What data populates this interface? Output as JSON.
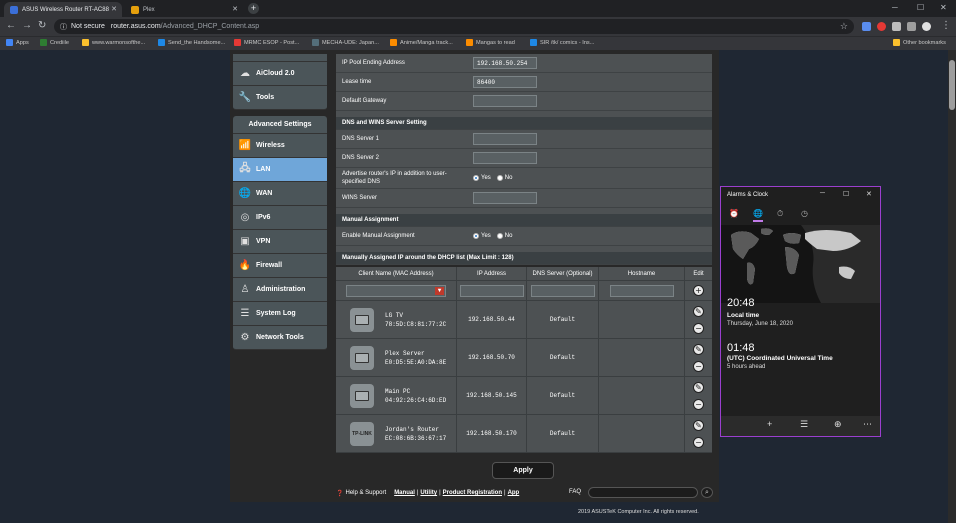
{
  "browser": {
    "tabs": [
      {
        "title": "ASUS Wireless Router RT-AC88"
      },
      {
        "title": "Plex"
      }
    ],
    "url": {
      "security": "Not secure",
      "host": "router.asus.com",
      "path": "/Advanced_DHCP_Content.asp"
    },
    "bookmarks": [
      {
        "label": "Apps",
        "color": "#4285f4"
      },
      {
        "label": "Crediile",
        "color": "#2e7d32"
      },
      {
        "label": "www.warmonsofthe...",
        "color": "#fbc02d"
      },
      {
        "label": "Send_the Handsome...",
        "color": "#1e88e5"
      },
      {
        "label": "MRMC ESOP - Post...",
        "color": "#e53935"
      },
      {
        "label": "MECHA-UDE: Japan...",
        "color": "#546e7a"
      },
      {
        "label": "Anime/Manga track...",
        "color": "#fb8c00"
      },
      {
        "label": "Mangas to read",
        "color": "#fb8c00"
      },
      {
        "label": "SIR /tk/ comics - Ins...",
        "color": "#1e88e5"
      },
      {
        "label": "Other bookmarks",
        "color": "#fbc02d"
      }
    ]
  },
  "sidebar": {
    "top_items": [
      {
        "label": "AiCloud 2.0",
        "icon": "cloud-icon"
      },
      {
        "label": "Tools",
        "icon": "wrench-icon"
      }
    ],
    "advanced_header": "Advanced Settings",
    "items": [
      {
        "label": "Wireless",
        "icon": "wireless-icon",
        "active": false
      },
      {
        "label": "LAN",
        "icon": "lan-icon",
        "active": true
      },
      {
        "label": "WAN",
        "icon": "globe-icon",
        "active": false
      },
      {
        "label": "IPv6",
        "icon": "ipv6-icon",
        "active": false
      },
      {
        "label": "VPN",
        "icon": "vpn-icon",
        "active": false
      },
      {
        "label": "Firewall",
        "icon": "fire-icon",
        "active": false
      },
      {
        "label": "Administration",
        "icon": "admin-icon",
        "active": false
      },
      {
        "label": "System Log",
        "icon": "log-icon",
        "active": false
      },
      {
        "label": "Network Tools",
        "icon": "gear-icon",
        "active": false
      }
    ]
  },
  "dhcp": {
    "pool_end_label": "IP Pool Ending Address",
    "pool_end_value": "192.168.50.254",
    "lease_label": "Lease time",
    "lease_value": "86400",
    "gateway_label": "Default Gateway",
    "gateway_value": ""
  },
  "dns": {
    "section_title": "DNS and WINS Server Setting",
    "dns1_label": "DNS Server 1",
    "dns2_label": "DNS Server 2",
    "advertise_label": "Advertise router's IP in addition to user-specified DNS",
    "yes": "Yes",
    "no": "No",
    "wins_label": "WINS Server"
  },
  "manual": {
    "section_title": "Manual Assignment",
    "enable_label": "Enable Manual Assignment",
    "yes": "Yes",
    "no": "No",
    "list_title": "Manually Assigned IP around the DHCP list (Max Limit : 128)"
  },
  "table": {
    "headers": [
      "Client Name (MAC Address)",
      "IP Address",
      "DNS Server (Optional)",
      "Hostname",
      "Edit"
    ],
    "rows": [
      {
        "name": "LG TV",
        "mac": "78:5D:C8:81:77:2C",
        "ip": "192.168.50.44",
        "dns": "Default",
        "icon": "tv-icon"
      },
      {
        "name": "Plex Server",
        "mac": "E0:D5:5E:A0:DA:8E",
        "ip": "192.168.50.70",
        "dns": "Default",
        "icon": "computer-icon"
      },
      {
        "name": "Main PC",
        "mac": "04:92:26:C4:6D:ED",
        "ip": "192.168.50.145",
        "dns": "Default",
        "icon": "computer-icon"
      },
      {
        "name": "Jordan's Router",
        "mac": "EC:08:6B:36:67:17",
        "ip": "192.168.50.170",
        "dns": "Default",
        "icon": "tplink-icon",
        "icon_text": "TP-LINK"
      }
    ]
  },
  "apply_label": "Apply",
  "footer": {
    "help": "Help & Support",
    "manual": "Manual",
    "utility": "Utility",
    "product_reg": "Product Registration",
    "app": "App",
    "faq": "FAQ",
    "copyright": "2019 ASUSTeK Computer Inc. All rights reserved."
  },
  "clock_app": {
    "title": "Alarms & Clock",
    "local_time": "20:48",
    "local_label": "Local time",
    "local_date": "Thursday, June 18, 2020",
    "utc_time": "01:48",
    "utc_label": "(UTC) Coordinated Universal Time",
    "utc_diff": "5 hours ahead"
  }
}
